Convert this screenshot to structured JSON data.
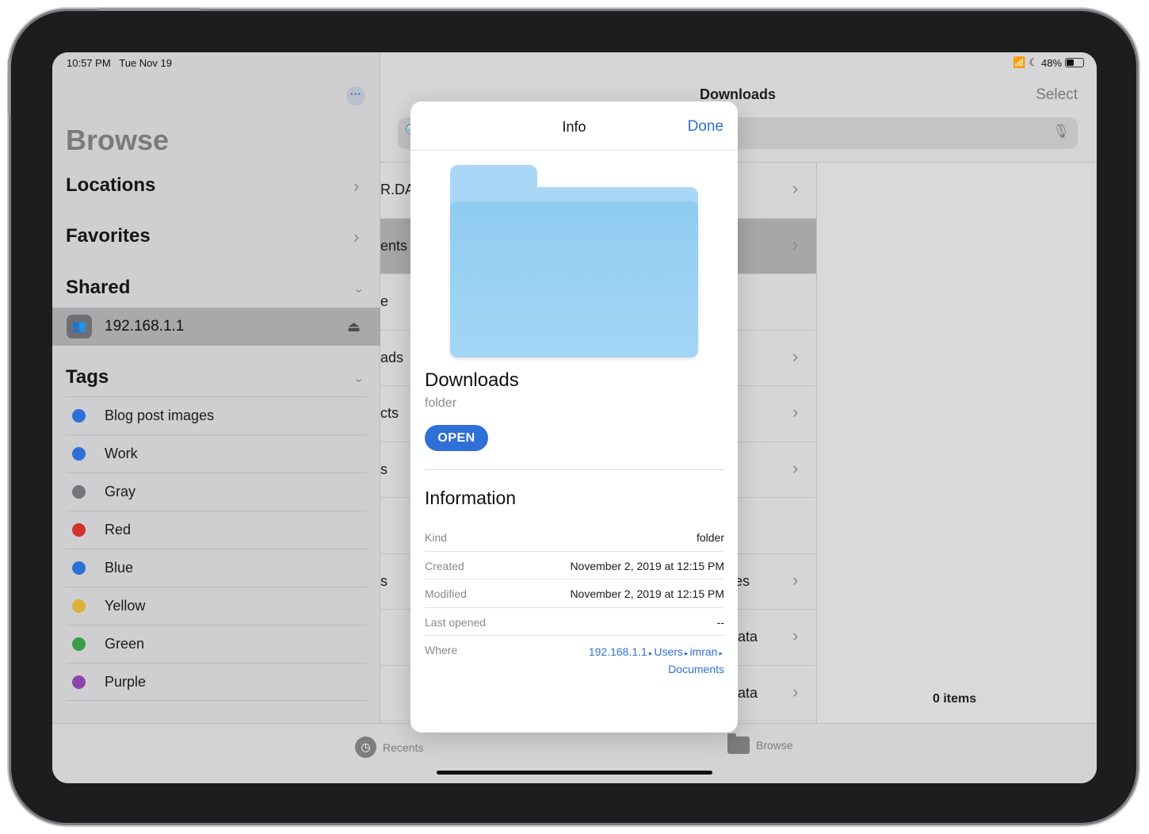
{
  "status_bar": {
    "time": "10:57 PM",
    "date": "Tue Nov 19",
    "battery": "48%"
  },
  "sidebar": {
    "title": "Browse",
    "sections": {
      "locations": "Locations",
      "favorites": "Favorites",
      "shared": "Shared",
      "tags": "Tags"
    },
    "shared_items": [
      {
        "label": "192.168.1.1"
      }
    ],
    "tags": [
      {
        "label": "Blog post images",
        "color": "#2f6fd8"
      },
      {
        "label": "Work",
        "color": "#2f6fd8"
      },
      {
        "label": "Gray",
        "color": "#76767a"
      },
      {
        "label": "Red",
        "color": "#d0342c"
      },
      {
        "label": "Blue",
        "color": "#2f6fd8"
      },
      {
        "label": "Yellow",
        "color": "#d8b23a"
      },
      {
        "label": "Green",
        "color": "#3a9c48"
      },
      {
        "label": "Purple",
        "color": "#8e44ad"
      }
    ]
  },
  "main": {
    "title": "Downloads",
    "select_label": "Select",
    "files": [
      {
        "name": "R.DAT"
      },
      {
        "name": "ents"
      },
      {
        "name": "e"
      },
      {
        "name": "ads"
      },
      {
        "name": "cts"
      },
      {
        "name": "s"
      },
      {
        "name": ""
      },
      {
        "name": "s"
      },
      {
        "name": ""
      },
      {
        "name": ""
      }
    ],
    "items_count": "0 items"
  },
  "popover": {
    "title": "Info",
    "done_label": "Done",
    "folder_name": "Downloads",
    "folder_kind": "folder",
    "open_label": "OPEN",
    "info_heading": "Information",
    "rows": [
      {
        "label": "Kind",
        "value": "folder"
      },
      {
        "label": "Created",
        "value": "November 2, 2019 at 12:15 PM"
      },
      {
        "label": "Modified",
        "value": "November 2, 2019 at 12:15 PM"
      },
      {
        "label": "Last opened",
        "value": "--"
      }
    ],
    "where_label": "Where",
    "where_path": [
      "192.168.1.1",
      "Users",
      "imran",
      "Documents"
    ]
  },
  "tabbar": {
    "recents": "Recents",
    "browse": "Browse"
  },
  "overlay_fragments": [
    "es",
    "ata",
    "ata"
  ]
}
